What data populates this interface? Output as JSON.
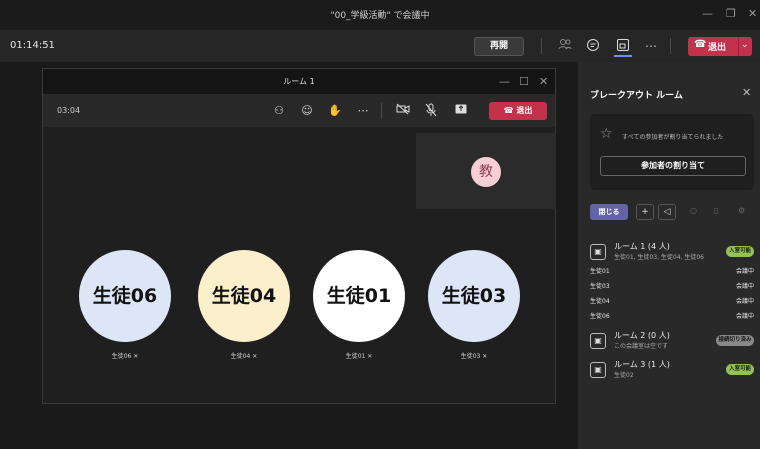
{
  "window": {
    "title": "\"00_学級活動\" で会議中",
    "min": "—",
    "restore": "❐",
    "close": "✕"
  },
  "toolbar": {
    "timer": "01:14:51",
    "resume_label": "再開",
    "icons": [
      "participants-icon",
      "chat-icon",
      "breakout-rooms-icon",
      "more-icon"
    ],
    "leave_label": "退出"
  },
  "room": {
    "title": "ルーム 1",
    "time": "03:04",
    "leave_label": "退出",
    "teacher_initial": "教",
    "students": [
      {
        "name": "生徒06",
        "label": "生徒06",
        "color": "#dde6f6"
      },
      {
        "name": "生徒04",
        "label": "生徒04",
        "color": "#fbefcc"
      },
      {
        "name": "生徒01",
        "label": "生徒01",
        "color": "#ffffff"
      },
      {
        "name": "生徒03",
        "label": "生徒03",
        "color": "#dde6f6"
      }
    ]
  },
  "panel": {
    "title": "ブレークアウト ルーム",
    "assigned_msg": "すべての参加者が割り当てられました",
    "assign_btn": "参加者の割り当て",
    "close_btn": "閉じる",
    "rooms": [
      {
        "name": "ルーム 1 (4 人)",
        "sub": "生徒01, 生徒03, 生徒04, 生徒06",
        "badge": "入室可能"
      },
      {
        "name": "ルーム 2 (0 人)",
        "sub": "この会議室は空です",
        "badge": "接続切り済み"
      },
      {
        "name": "ルーム 3 (1 人)",
        "sub": "生徒02",
        "badge": "入室可能"
      }
    ],
    "members": [
      {
        "name": "生徒01",
        "status": "会議中"
      },
      {
        "name": "生徒03",
        "status": "会議中"
      },
      {
        "name": "生徒04",
        "status": "会議中"
      },
      {
        "name": "生徒06",
        "status": "会議中"
      }
    ]
  }
}
